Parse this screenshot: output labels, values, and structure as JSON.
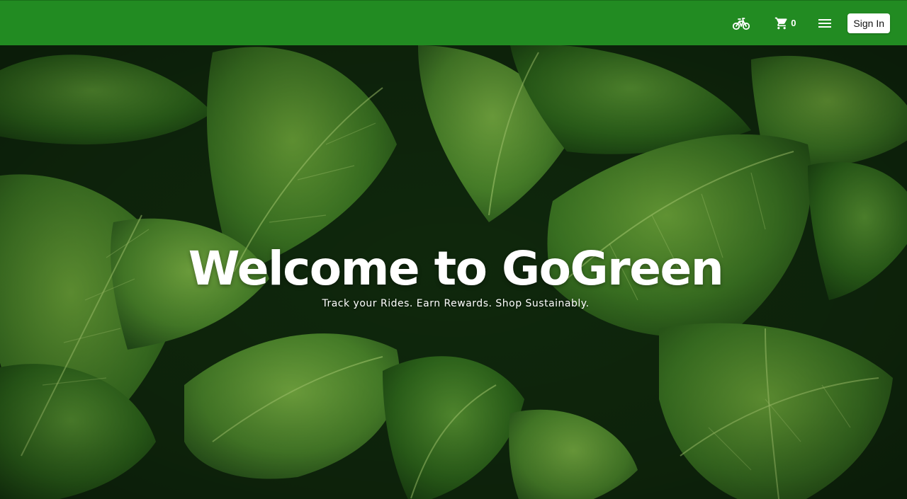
{
  "app": {
    "brand_color": "#228b22"
  },
  "navbar": {
    "ride_icon": "bicycle-icon",
    "cart_icon": "shopping-cart-icon",
    "cart_count": "0",
    "menu_icon": "hamburger-menu-icon",
    "signin_label": "Sign In"
  },
  "hero": {
    "background": "tropical-leaves-photo",
    "title": "Welcome to GoGreen",
    "subtitle": "Track your Rides. Earn Rewards. Shop Sustainably."
  }
}
